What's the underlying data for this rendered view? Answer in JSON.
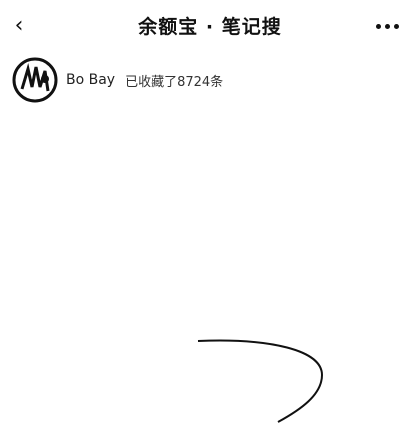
{
  "nav": {
    "back_icon": "chevron-left-icon",
    "title": "余额宝 · 笔记搜",
    "more_icon": "ellipsis-icon"
  },
  "user": {
    "avatar_icon": "avatar-icon",
    "name": "Bo Bay",
    "status": "已收藏了8724条"
  }
}
